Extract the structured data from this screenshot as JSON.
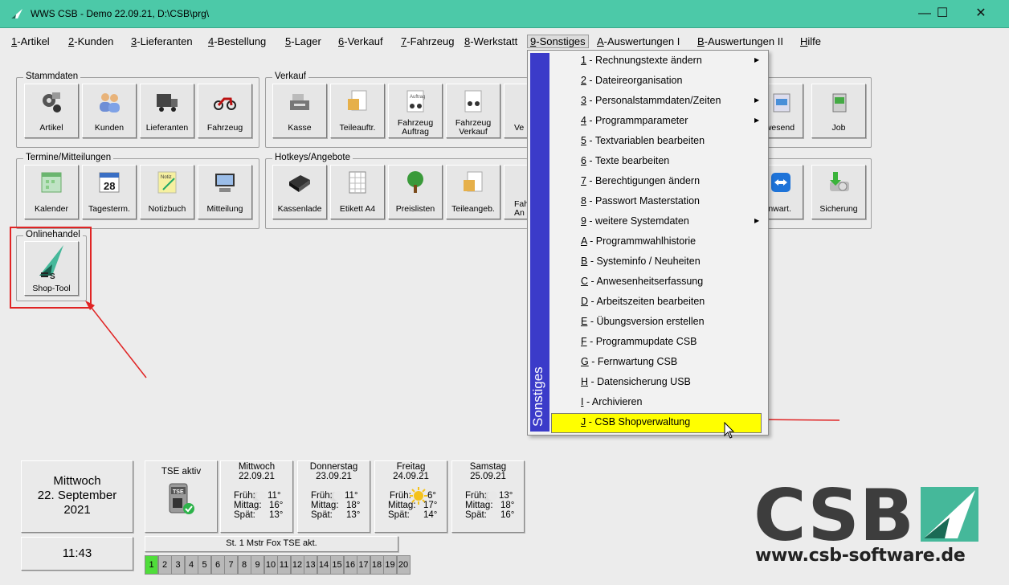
{
  "window": {
    "title": "WWS CSB - Demo  22.09.21, D:\\CSB\\prg\\",
    "minimize": "—",
    "maximize": "☐",
    "close": "✕"
  },
  "menu": [
    {
      "key": "1",
      "rest": "-Artikel"
    },
    {
      "key": "2",
      "rest": "-Kunden"
    },
    {
      "key": "3",
      "rest": "-Lieferanten"
    },
    {
      "key": "4",
      "rest": "-Bestellung"
    },
    {
      "key": "5",
      "rest": "-Lager"
    },
    {
      "key": "6",
      "rest": "-Verkauf"
    },
    {
      "key": "7",
      "rest": "-Fahrzeug"
    },
    {
      "key": "8",
      "rest": "-Werkstatt"
    },
    {
      "key": "9",
      "rest": "-Sonstiges"
    },
    {
      "key": "A",
      "rest": "-Auswertungen I"
    },
    {
      "key": "B",
      "rest": "-Auswertungen II"
    },
    {
      "key": "H",
      "rest": "ilfe"
    }
  ],
  "groups": {
    "stammdaten": {
      "title": "Stammdaten",
      "tiles": [
        "Artikel",
        "Kunden",
        "Lieferanten",
        "Fahrzeug"
      ]
    },
    "verkauf": {
      "title": "Verkauf",
      "tiles": [
        "Kasse",
        "Teileauftr.",
        "Fahrzeug Auftrag",
        "Fahrzeug Verkauf",
        "Ve",
        "nwesend",
        "Job"
      ]
    },
    "termine": {
      "title": "Termine/Mitteilungen",
      "tiles": [
        "Kalender",
        "Tagesterm.",
        "Notizbuch",
        "Mitteilung"
      ]
    },
    "hotkeys": {
      "title": "Hotkeys/Angebote",
      "tiles": [
        "Kassenlade",
        "Etikett A4",
        "Preislisten",
        "Teileangeb.",
        "Fah An",
        "ernwart.",
        "Sicherung"
      ]
    },
    "online": {
      "title": "Onlinehandel",
      "tiles": [
        "Shop-Tool"
      ]
    }
  },
  "calendar_day_icon": "28",
  "notiz_icon": "Notiz",
  "auftrag_icon": "Auftrag",
  "shop_icon_text": "S",
  "dropdown": {
    "sidebar_label": "Sonstiges",
    "items": [
      {
        "key": "1",
        "rest": " - Rechnungstexte ändern",
        "submenu": true
      },
      {
        "key": "2",
        "rest": " - Dateireorganisation",
        "submenu": false
      },
      {
        "key": "3",
        "rest": " - Personalstammdaten/Zeiten",
        "submenu": true
      },
      {
        "key": "4",
        "rest": " - Programmparameter",
        "submenu": true
      },
      {
        "key": "5",
        "rest": " - Textvariablen bearbeiten",
        "submenu": false
      },
      {
        "key": "6",
        "rest": " - Texte bearbeiten",
        "submenu": false
      },
      {
        "key": "7",
        "rest": " - Berechtigungen ändern",
        "submenu": false
      },
      {
        "key": "8",
        "rest": " - Passwort Masterstation",
        "submenu": false
      },
      {
        "key": "9",
        "rest": " - weitere Systemdaten",
        "submenu": true
      },
      {
        "key": "A",
        "rest": " - Programmwahlhistorie",
        "submenu": false
      },
      {
        "key": "B",
        "rest": " - Systeminfo / Neuheiten",
        "submenu": false
      },
      {
        "key": "C",
        "rest": " - Anwesenheitserfassung",
        "submenu": false
      },
      {
        "key": "D",
        "rest": " - Arbeitszeiten bearbeiten",
        "submenu": false
      },
      {
        "key": "E",
        "rest": " - Übungsversion erstellen",
        "submenu": false
      },
      {
        "key": "F",
        "rest": " - Programmupdate CSB",
        "submenu": false
      },
      {
        "key": "G",
        "rest": " - Fernwartung CSB",
        "submenu": false
      },
      {
        "key": "H",
        "rest": " - Datensicherung USB",
        "submenu": false
      },
      {
        "key": "I",
        "rest": " - Archivieren",
        "submenu": false
      },
      {
        "key": "J",
        "rest": " - CSB Shopverwaltung",
        "submenu": false
      }
    ]
  },
  "date_panel": {
    "weekday": "Mittwoch",
    "date": "22. September",
    "year": "2021",
    "time": "11:43"
  },
  "tse": {
    "label": "TSE aktiv",
    "chip": "TSE",
    "status": "St. 1 Mstr Fox TSE akt."
  },
  "weather": [
    {
      "day": "Mittwoch",
      "date": "22.09.21",
      "frueh": "11°",
      "mittag": "16°",
      "spaet": "13°"
    },
    {
      "day": "Donnerstag",
      "date": "23.09.21",
      "frueh": "11°",
      "mittag": "18°",
      "spaet": "13°"
    },
    {
      "day": "Freitag",
      "date": "24.09.21",
      "frueh": "6°",
      "mittag": "17°",
      "spaet": "14°"
    },
    {
      "day": "Samstag",
      "date": "25.09.21",
      "frueh": "13°",
      "mittag": "18°",
      "spaet": "16°"
    }
  ],
  "weather_labels": {
    "frueh": "Früh:",
    "mittag": "Mittag:",
    "spaet": "Spät:"
  },
  "stations": [
    "1",
    "2",
    "3",
    "4",
    "5",
    "6",
    "7",
    "8",
    "9",
    "10",
    "11",
    "12",
    "13",
    "14",
    "15",
    "16",
    "17",
    "18",
    "19",
    "20"
  ],
  "active_station": "1",
  "brand": {
    "logo": "CSB",
    "url": "www.csb-software.de"
  },
  "colors": {
    "titlebar": "#4cc9a8",
    "dropdown_sidebar": "#3b3bc9",
    "highlight": "#ffff00",
    "annotation_red": "#e02424",
    "station_on": "#4fdd3a"
  }
}
